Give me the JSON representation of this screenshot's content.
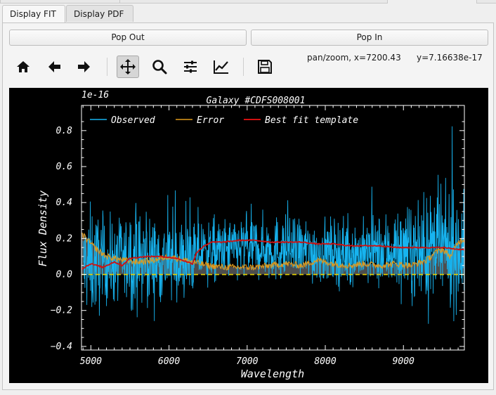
{
  "tabs": [
    {
      "label": "Display FIT",
      "active": true
    },
    {
      "label": "Display PDF",
      "active": false
    }
  ],
  "buttons": {
    "pop_out": "Pop Out",
    "pop_in": "Pop In"
  },
  "toolbar": {
    "tools": [
      "home-icon",
      "back-arrow-icon",
      "forward-arrow-icon",
      "pan-move-icon",
      "zoom-magnifier-icon",
      "configure-subplots-icon",
      "edit-axes-icon",
      "save-disk-icon"
    ],
    "active_tool": "pan-move-icon",
    "mode_text": "pan/zoom, x=7200.43",
    "y_text": "y=7.16638e-17"
  },
  "chart_data": {
    "type": "line",
    "title": "Galaxy #CDFS008001",
    "xlabel": "Wavelength",
    "ylabel": "Flux Density",
    "offset_text": "1e-16",
    "xlim": [
      4880,
      9780
    ],
    "ylim": [
      -0.42,
      0.94
    ],
    "x_ticks": [
      5000,
      6000,
      7000,
      8000,
      9000
    ],
    "y_ticks": [
      -0.4,
      -0.2,
      0.0,
      0.2,
      0.4,
      0.6,
      0.8
    ],
    "x_tick_labels": [
      "5000",
      "6000",
      "7000",
      "8000",
      "9000"
    ],
    "y_tick_labels": [
      "−0.4",
      "−0.2",
      "0.0",
      "0.2",
      "0.4",
      "0.6",
      "0.8"
    ],
    "legend": {
      "placement": "top-left"
    },
    "colors": {
      "background": "#000000",
      "observed": "#17b4f0",
      "error": "#e09a1c",
      "best_fit": "#d01010",
      "zero_line": "#e6d200",
      "axes": "#ffffff"
    },
    "series": [
      {
        "name": "Observed",
        "note_style": "noisy spectrum",
        "x": [
          4900,
          5000,
          5200,
          5400,
          5600,
          5800,
          6000,
          6200,
          6400,
          6600,
          6800,
          7000,
          7200,
          7400,
          7600,
          7800,
          8000,
          8200,
          8400,
          8600,
          8800,
          9000,
          9200,
          9400,
          9600,
          9780
        ],
        "y": [
          0.05,
          0.06,
          0.07,
          0.08,
          0.08,
          0.08,
          0.08,
          0.07,
          0.12,
          0.13,
          0.14,
          0.15,
          0.15,
          0.14,
          0.14,
          0.13,
          0.13,
          0.12,
          0.12,
          0.12,
          0.13,
          0.13,
          0.12,
          0.14,
          0.13,
          0.14
        ],
        "spread": [
          0.35,
          0.4,
          0.3,
          0.3,
          0.32,
          0.3,
          0.3,
          0.28,
          0.25,
          0.22,
          0.22,
          0.24,
          0.22,
          0.24,
          0.22,
          0.24,
          0.22,
          0.24,
          0.22,
          0.25,
          0.28,
          0.3,
          0.32,
          0.4,
          0.4,
          0.38
        ]
      },
      {
        "name": "Error",
        "x": [
          4900,
          5000,
          5100,
          5200,
          5400,
          5600,
          5800,
          6000,
          6200,
          6400,
          6500,
          6700,
          6900,
          7100,
          7300,
          7500,
          7700,
          7900,
          8100,
          8300,
          8500,
          8700,
          8900,
          9100,
          9300,
          9400,
          9500,
          9600,
          9700,
          9780
        ],
        "y": [
          0.22,
          0.17,
          0.13,
          0.1,
          0.08,
          0.07,
          0.08,
          0.1,
          0.08,
          0.06,
          0.05,
          0.04,
          0.04,
          0.04,
          0.05,
          0.06,
          0.05,
          0.08,
          0.06,
          0.05,
          0.06,
          0.05,
          0.06,
          0.05,
          0.08,
          0.12,
          0.14,
          0.1,
          0.18,
          0.2
        ]
      },
      {
        "name": "Best fit template",
        "x": [
          4880,
          5000,
          5150,
          5300,
          5400,
          5500,
          5700,
          5900,
          6100,
          6300,
          6350,
          6450,
          6550,
          6700,
          6900,
          7100,
          7300,
          7500,
          7700,
          7900,
          8100,
          8300,
          8500,
          8700,
          8900,
          9100,
          9300,
          9500,
          9700,
          9780
        ],
        "y": [
          0.03,
          0.06,
          0.04,
          0.07,
          0.05,
          0.09,
          0.1,
          0.1,
          0.09,
          0.06,
          0.12,
          0.16,
          0.18,
          0.18,
          0.19,
          0.19,
          0.18,
          0.18,
          0.18,
          0.17,
          0.17,
          0.16,
          0.16,
          0.16,
          0.15,
          0.15,
          0.15,
          0.15,
          0.14,
          0.14
        ]
      }
    ]
  }
}
